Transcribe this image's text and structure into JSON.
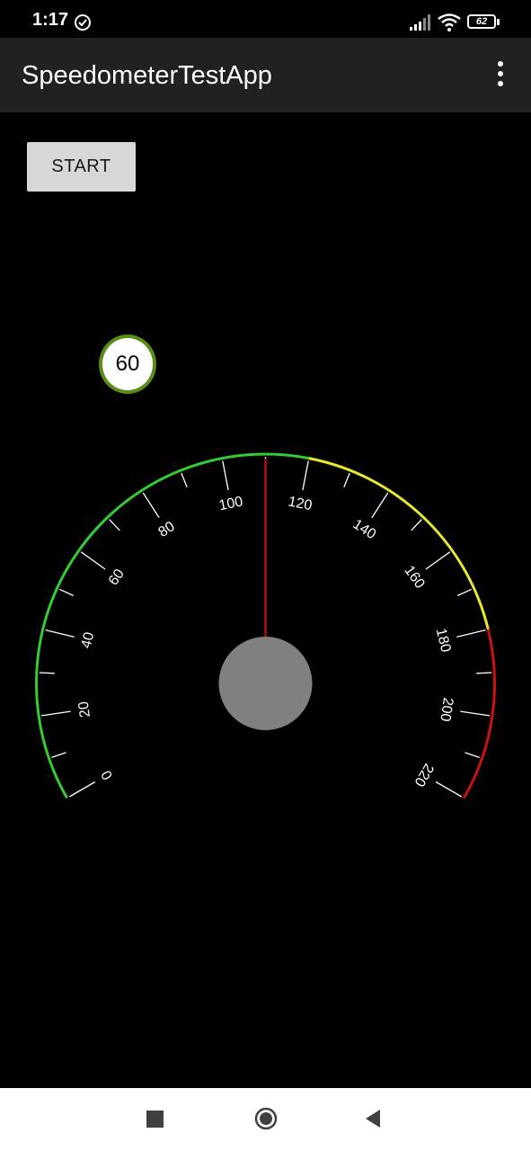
{
  "status_bar": {
    "time": "1:17",
    "battery_level": "62",
    "icons": [
      "sync-icon",
      "signal-icon",
      "wifi-icon",
      "battery-icon"
    ]
  },
  "app_bar": {
    "title": "SpeedometerTestApp",
    "overflow_icon": "more-vert-icon"
  },
  "controls": {
    "start_label": "START"
  },
  "speed_badge": {
    "value": "60"
  },
  "gauge": {
    "min": 0,
    "max": 220,
    "major_step": 20,
    "minor_step": 10,
    "tick_labels": [
      "0",
      "20",
      "40",
      "60",
      "80",
      "100",
      "120",
      "140",
      "160",
      "180",
      "200",
      "220"
    ],
    "needle_value": 110,
    "zones": [
      {
        "from": 0,
        "to": 120,
        "color": "#33cc33"
      },
      {
        "from": 120,
        "to": 180,
        "color": "#e8e82e"
      },
      {
        "from": 180,
        "to": 220,
        "color": "#cc1111"
      }
    ],
    "needle_color": "#b01010",
    "hub_color": "#808080"
  },
  "nav_bar": {
    "icons": [
      "recents-icon",
      "home-icon",
      "back-icon"
    ]
  }
}
